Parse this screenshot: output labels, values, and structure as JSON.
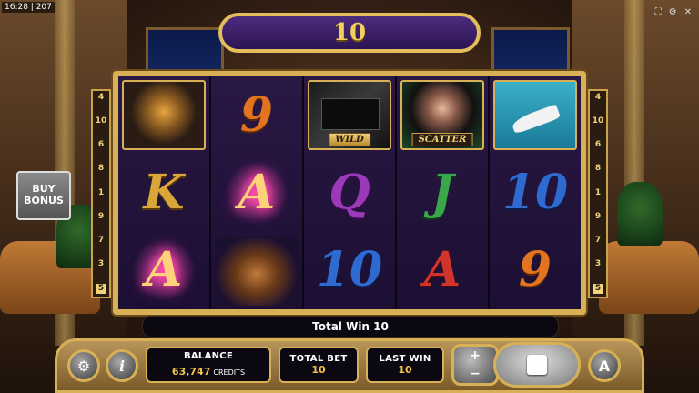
{
  "status_bar": {
    "time": "16:28",
    "number": "207"
  },
  "top_icons": [
    "fullscreen-icon",
    "settings-icon",
    "close-icon"
  ],
  "banner": {
    "value": "10"
  },
  "paylines_left": [
    "4",
    "10",
    "6",
    "8",
    "1",
    "9",
    "7",
    "3",
    "5"
  ],
  "paylines_right": [
    "4",
    "10",
    "6",
    "8",
    "1",
    "9",
    "7",
    "3",
    "5"
  ],
  "reels": [
    [
      {
        "type": "image",
        "name": "whisky"
      },
      {
        "type": "letter",
        "text": "K",
        "color": "gold"
      },
      {
        "type": "letter",
        "text": "A",
        "color": "lit"
      }
    ],
    [
      {
        "type": "letter",
        "text": "9",
        "color": "orange"
      },
      {
        "type": "letter",
        "text": "A",
        "color": "lit"
      },
      {
        "type": "image",
        "name": "car"
      }
    ],
    [
      {
        "type": "image",
        "name": "case",
        "label": "WILD"
      },
      {
        "type": "letter",
        "text": "Q",
        "color": "purple"
      },
      {
        "type": "letter",
        "text": "10",
        "color": "blue"
      }
    ],
    [
      {
        "type": "image",
        "name": "lady",
        "label": "SCATTER"
      },
      {
        "type": "letter",
        "text": "J",
        "color": "green"
      },
      {
        "type": "letter",
        "text": "A",
        "color": "red"
      }
    ],
    [
      {
        "type": "image",
        "name": "yacht"
      },
      {
        "type": "letter",
        "text": "10",
        "color": "blue"
      },
      {
        "type": "letter",
        "text": "9",
        "color": "orange"
      }
    ]
  ],
  "buy_bonus": {
    "line1": "BUY",
    "line2": "BONUS"
  },
  "total_win": "Total Win 10",
  "balance": {
    "label": "BALANCE",
    "value": "63,747",
    "unit": "CREDITS"
  },
  "total_bet": {
    "label": "TOTAL BET",
    "value": "10"
  },
  "last_win": {
    "label": "LAST WIN",
    "value": "10"
  },
  "buttons": {
    "info": "i",
    "plus": "+",
    "minus": "−",
    "autoplay": "A"
  }
}
